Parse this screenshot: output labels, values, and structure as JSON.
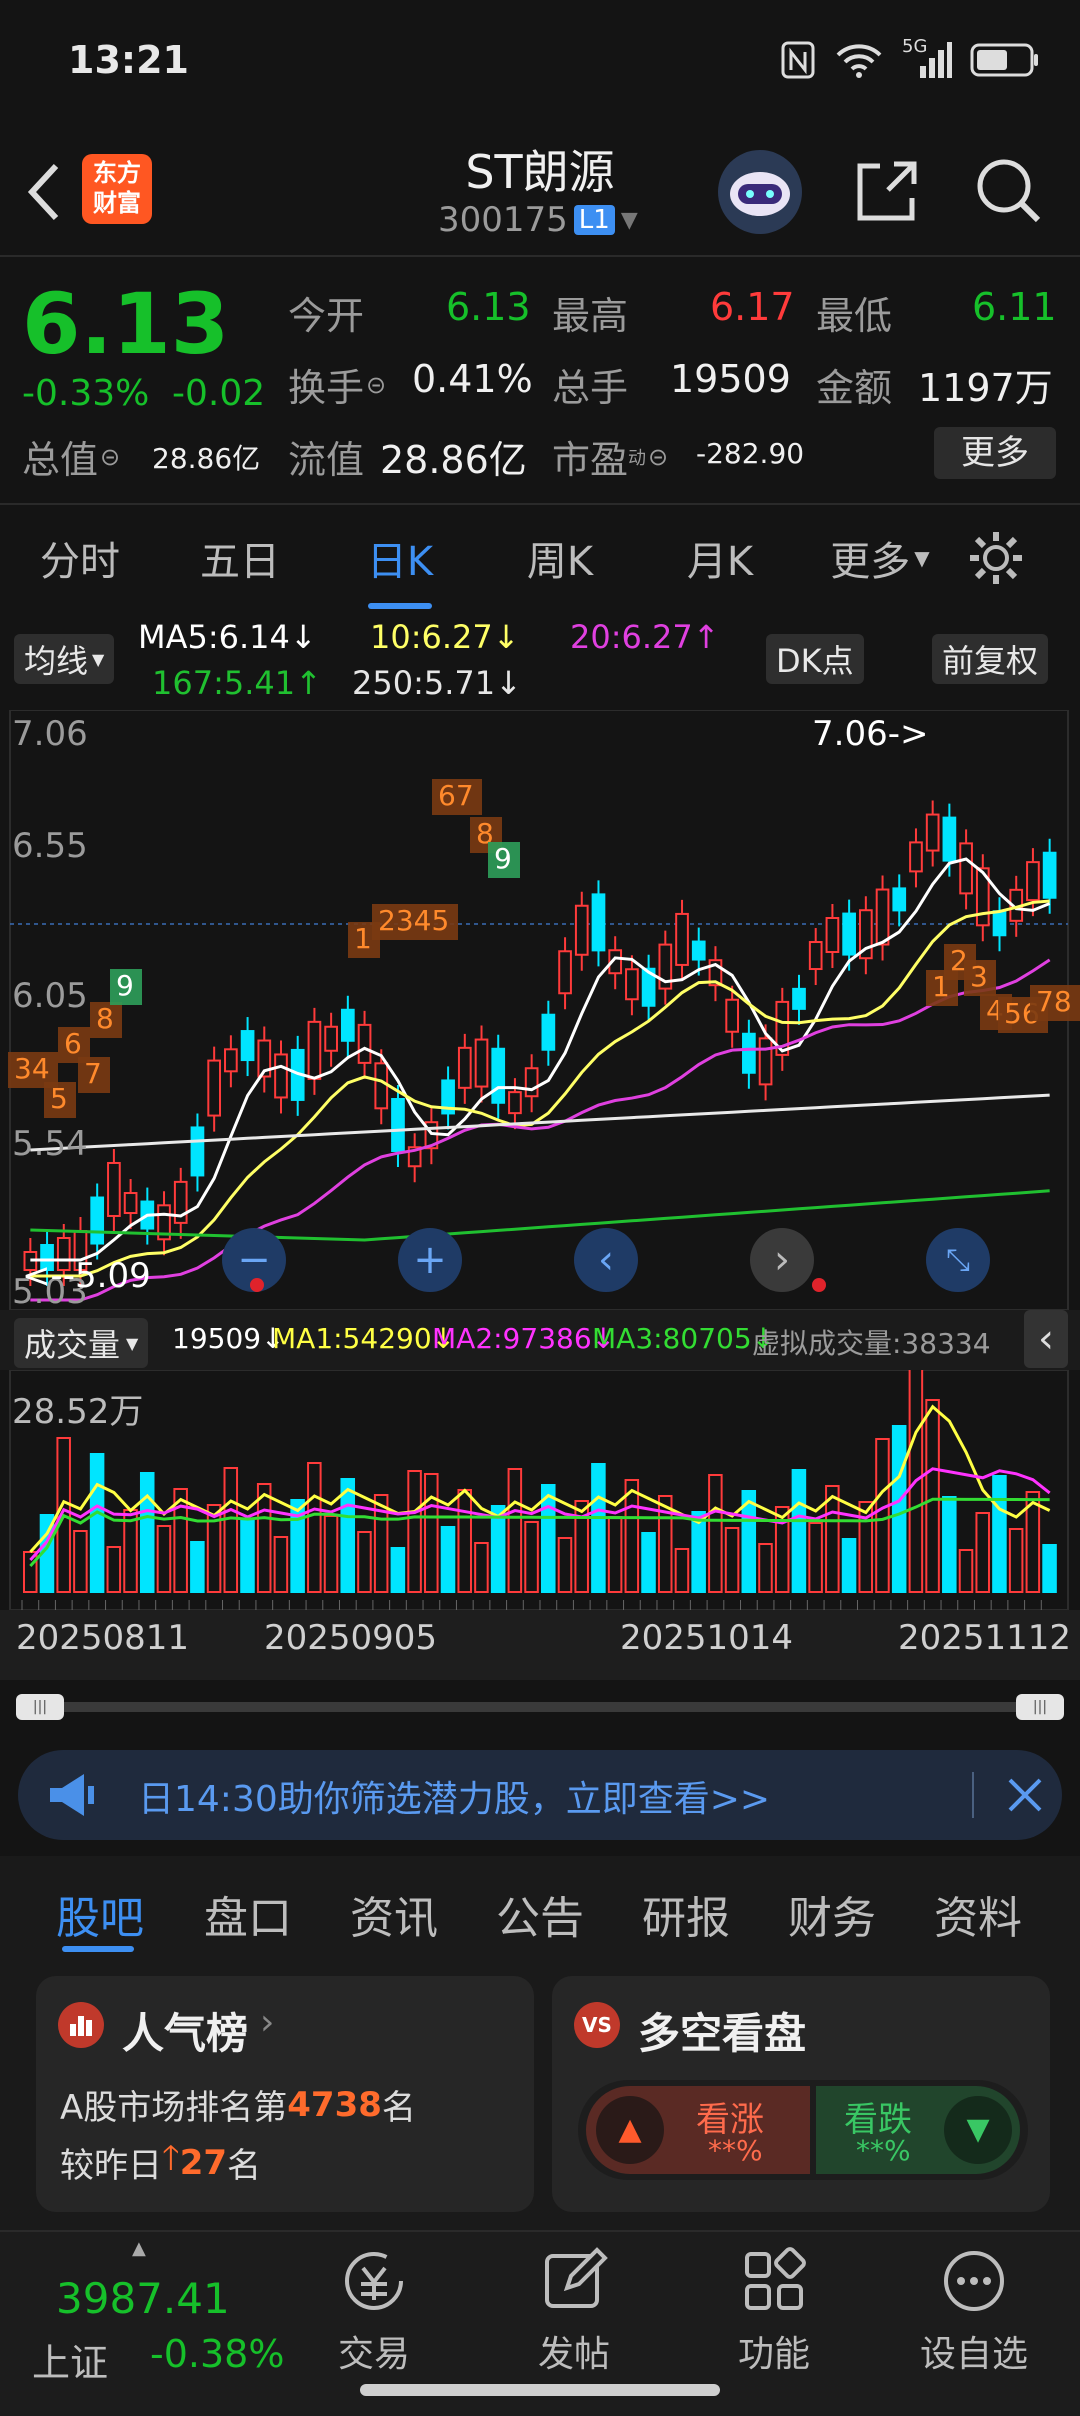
{
  "status": {
    "time": "13:21",
    "network": "5G"
  },
  "header": {
    "logo_line1": "东方",
    "logo_line2": "财富",
    "title": "ST朗源",
    "code": "300175",
    "level": "L1"
  },
  "quote": {
    "price": "6.13",
    "change_pct": "-0.33%",
    "change": "-0.02",
    "open_label": "今开",
    "open": "6.13",
    "high_label": "最高",
    "high": "6.17",
    "low_label": "最低",
    "low": "6.11",
    "turnover_label": "换手",
    "turnover": "0.41%",
    "volume_label": "总手",
    "volume": "19509",
    "amount_label": "金额",
    "amount": "1197万",
    "mktcap_label": "总值",
    "mktcap": "28.86亿",
    "float_label": "流值",
    "float": "28.86亿",
    "pe_label": "市盈",
    "pe_sup": "动",
    "pe": "-282.90",
    "more": "更多"
  },
  "tabs": [
    "分时",
    "五日",
    "日K",
    "周K",
    "月K",
    "更多"
  ],
  "ma": {
    "tag": "均线",
    "ma5": "MA5:6.14↓",
    "ma10": "10:6.27↓",
    "ma20": "20:6.27↑",
    "ma167": "167:5.41↑",
    "ma250": "250:5.71↓",
    "dk": "DK点",
    "fq": "前复权"
  },
  "kline": {
    "y_labels": [
      "7.06",
      "6.55",
      "6.05",
      "5.54",
      "5.03"
    ],
    "max_label": "7.06->",
    "min_label": "<--5.09",
    "signals": [
      "34",
      "5",
      "6",
      "7",
      "8",
      "9",
      "1",
      "2345",
      "67",
      "8",
      "9",
      "1",
      "2",
      "3",
      "4",
      "56",
      "78"
    ]
  },
  "volume": {
    "tag": "成交量",
    "v": "19509↓",
    "ma1": "MA1:54290↓",
    "ma2": "MA2:97386↓",
    "ma3": "MA3:80705↓",
    "virtual": "虚拟成交量:38334",
    "max": "28.52万"
  },
  "dates": [
    "20250811",
    "20250905",
    "20251014",
    "20251112"
  ],
  "banner": {
    "text": "日14:30助你筛选潜力股，立即查看>>"
  },
  "bottom_tabs": [
    "股吧",
    "盘口",
    "资讯",
    "公告",
    "研报",
    "财务",
    "资料"
  ],
  "rank": {
    "title": "人气榜",
    "line1_pre": "A股市场排名第",
    "rank": "4738",
    "line1_post": "名",
    "line2_pre": "较昨日",
    "delta": "27",
    "line2_post": "名"
  },
  "longshort": {
    "title": "多空看盘",
    "up": "看涨",
    "up_val": "**%",
    "down": "看跌",
    "down_val": "**%"
  },
  "nav": {
    "index_value": "3987.41",
    "index_name": "上证",
    "index_change": "-0.38%",
    "trade": "交易",
    "post": "发帖",
    "func": "功能",
    "watch": "设自选"
  },
  "colors": {
    "up": "#ff3b3b",
    "down": "#16c02a",
    "accent": "#3d8ff2",
    "cyan": "#00e5ff",
    "ma5": "#ffffff",
    "ma10": "#ffff66",
    "ma20": "#e040e0",
    "ma167": "#20c030"
  }
}
